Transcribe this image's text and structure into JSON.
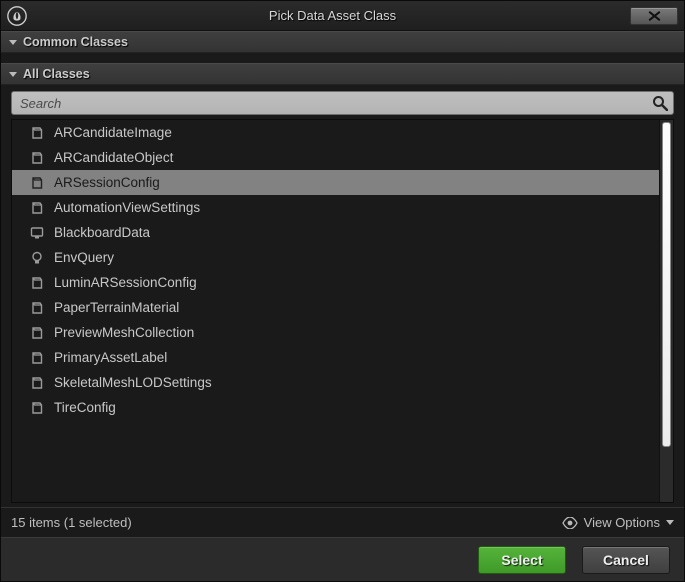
{
  "title": "Pick Data Asset Class",
  "sections": {
    "common": "Common Classes",
    "all": "All Classes"
  },
  "search": {
    "placeholder": "Search"
  },
  "items": [
    {
      "label": "ARCandidateImage",
      "icon": "asset",
      "selected": false
    },
    {
      "label": "ARCandidateObject",
      "icon": "asset",
      "selected": false
    },
    {
      "label": "ARSessionConfig",
      "icon": "asset",
      "selected": true
    },
    {
      "label": "AutomationViewSettings",
      "icon": "asset",
      "selected": false
    },
    {
      "label": "BlackboardData",
      "icon": "blackboard",
      "selected": false
    },
    {
      "label": "EnvQuery",
      "icon": "bulb",
      "selected": false
    },
    {
      "label": "LuminARSessionConfig",
      "icon": "asset",
      "selected": false
    },
    {
      "label": "PaperTerrainMaterial",
      "icon": "asset",
      "selected": false
    },
    {
      "label": "PreviewMeshCollection",
      "icon": "asset",
      "selected": false
    },
    {
      "label": "PrimaryAssetLabel",
      "icon": "asset",
      "selected": false
    },
    {
      "label": "SkeletalMeshLODSettings",
      "icon": "asset",
      "selected": false
    },
    {
      "label": "TireConfig",
      "icon": "asset",
      "selected": false
    }
  ],
  "footer": {
    "status": "15 items (1 selected)",
    "view_options": "View Options"
  },
  "buttons": {
    "select": "Select",
    "cancel": "Cancel"
  }
}
